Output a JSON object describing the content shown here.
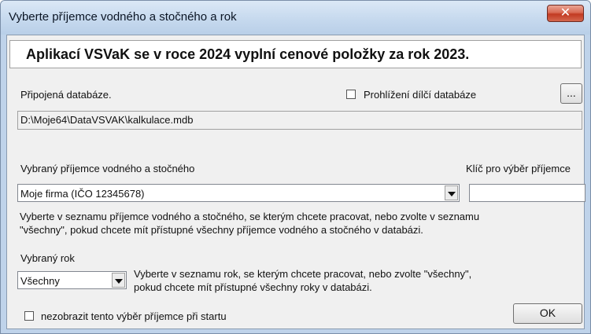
{
  "window": {
    "title": "Vyberte příjemce vodného a stočného a rok",
    "close_label": "✕"
  },
  "headline": "Aplikací VSVaK se v roce 2024 vyplní cenové položky za rok 2023.",
  "database": {
    "label": "Připojená databáze.",
    "checkbox_label": "Prohlížení dílčí databáze",
    "browse_label": "...",
    "path": "D:\\Moje64\\DataVSVAK\\kalkulace.mdb"
  },
  "recipient": {
    "label": "Vybraný příjemce vodného a stočného",
    "key_label": "Klíč pro výběr příjemce",
    "selected": "Moje firma (IČO 12345678)",
    "key_value": "",
    "hint_line1": "Vyberte v seznamu příjemce vodného a stočného, se kterým chcete pracovat, nebo zvolte v seznamu",
    "hint_line2": "\"všechny\", pokud chcete mít přístupné všechny příjemce vodného a stočného v databázi."
  },
  "year": {
    "label": "Vybraný rok",
    "selected": "Všechny",
    "hint_line1": "Vyberte v seznamu rok, se kterým chcete pracovat, nebo zvolte \"všechny\",",
    "hint_line2": "pokud chcete mít přístupné všechny roky v databázi."
  },
  "footer": {
    "startup_checkbox_label": "nezobrazit tento výběr příjemce při startu",
    "ok_label": "OK"
  }
}
